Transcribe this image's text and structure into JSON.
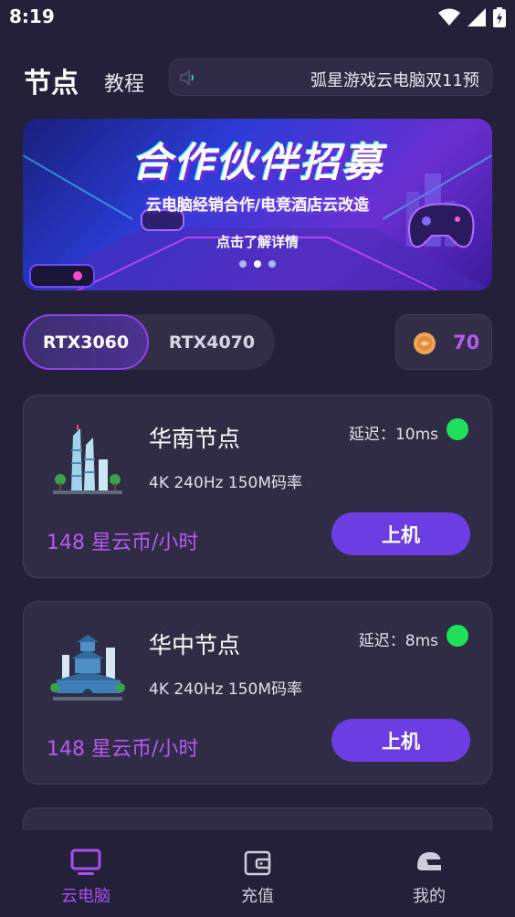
{
  "status_bar": {
    "time": "8:19"
  },
  "header": {
    "tab_nodes": "节点",
    "tab_tutorial": "教程",
    "announcement": "弧星游戏云电脑双11预"
  },
  "banner": {
    "title": "合作伙伴招募",
    "subtitle": "云电脑经销合作/电竞酒店云改造",
    "cta": "点击了解详情"
  },
  "gpu_options": [
    {
      "label": "RTX3060",
      "selected": true
    },
    {
      "label": "RTX4070",
      "selected": false
    }
  ],
  "coins": {
    "value": "70"
  },
  "nodes": [
    {
      "name": "华南节点",
      "latency": "延迟：10ms",
      "spec": "4K 240Hz 150M码率",
      "price": "148 星云币/小时",
      "button": "上机",
      "status_color": "#1ee05a"
    },
    {
      "name": "华中节点",
      "latency": "延迟：8ms",
      "spec": "4K 240Hz 150M码率",
      "price": "148 星云币/小时",
      "button": "上机",
      "status_color": "#1ee05a"
    }
  ],
  "bottom_nav": [
    {
      "label": "云电脑",
      "icon": "monitor-icon",
      "active": true
    },
    {
      "label": "充值",
      "icon": "wallet-icon",
      "active": false
    },
    {
      "label": "我的",
      "icon": "helmet-icon",
      "active": false
    }
  ],
  "colors": {
    "background": "#24203a",
    "accent_purple": "#6b3de2",
    "price_purple": "#b659f2",
    "online_green": "#1ee05a"
  }
}
